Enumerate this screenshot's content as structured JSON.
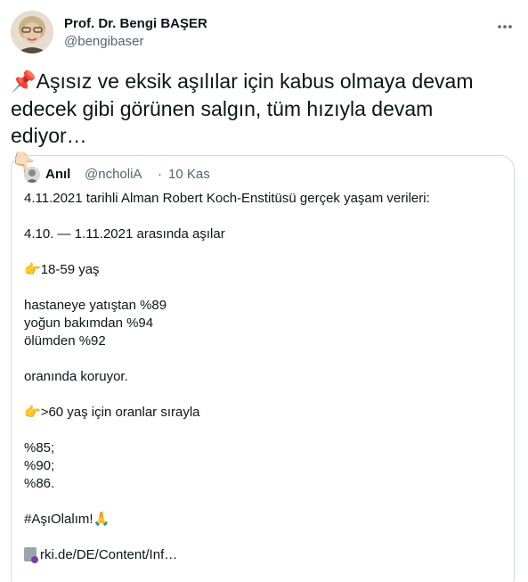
{
  "author": {
    "name": "Prof. Dr. Bengi BAŞER",
    "handle": "@bengibaser",
    "more_icon": "ellipsis-icon"
  },
  "tweet": {
    "line1_emoji": "📌",
    "line1": "Aşısız ve eksik aşılılar için kabus olmaya devam",
    "line2": "edecek gibi görünen salgın, tüm hızıyla devam ediyor…",
    "line3_emoji": "👇🏻"
  },
  "quote": {
    "name": "Anıl",
    "handle": "@ncholiA",
    "separator": "·",
    "time": "10 Kas",
    "lines": {
      "l1": "4.11.2021 tarihli Alman Robert Koch-Enstitüsü gerçek yaşam verileri:",
      "l2": "4.10. — 1.11.2021 arasında aşılar",
      "l3_emoji": "👉",
      "l3": "18-59 yaş",
      "l4": "hastaneye yatıştan %89",
      "l5": "yoğun bakımdan %94",
      "l6": "ölümden %92",
      "l7": "oranında koruyor.",
      "l8_emoji": "👉",
      "l8": ">60 yaş için oranlar sırayla",
      "l9": "%85;",
      "l10": "%90;",
      "l11": "%86.",
      "l12": "#AşıOlalım!",
      "l12_emoji": "🙏",
      "l13": "rki.de/DE/Content/Inf…"
    }
  }
}
